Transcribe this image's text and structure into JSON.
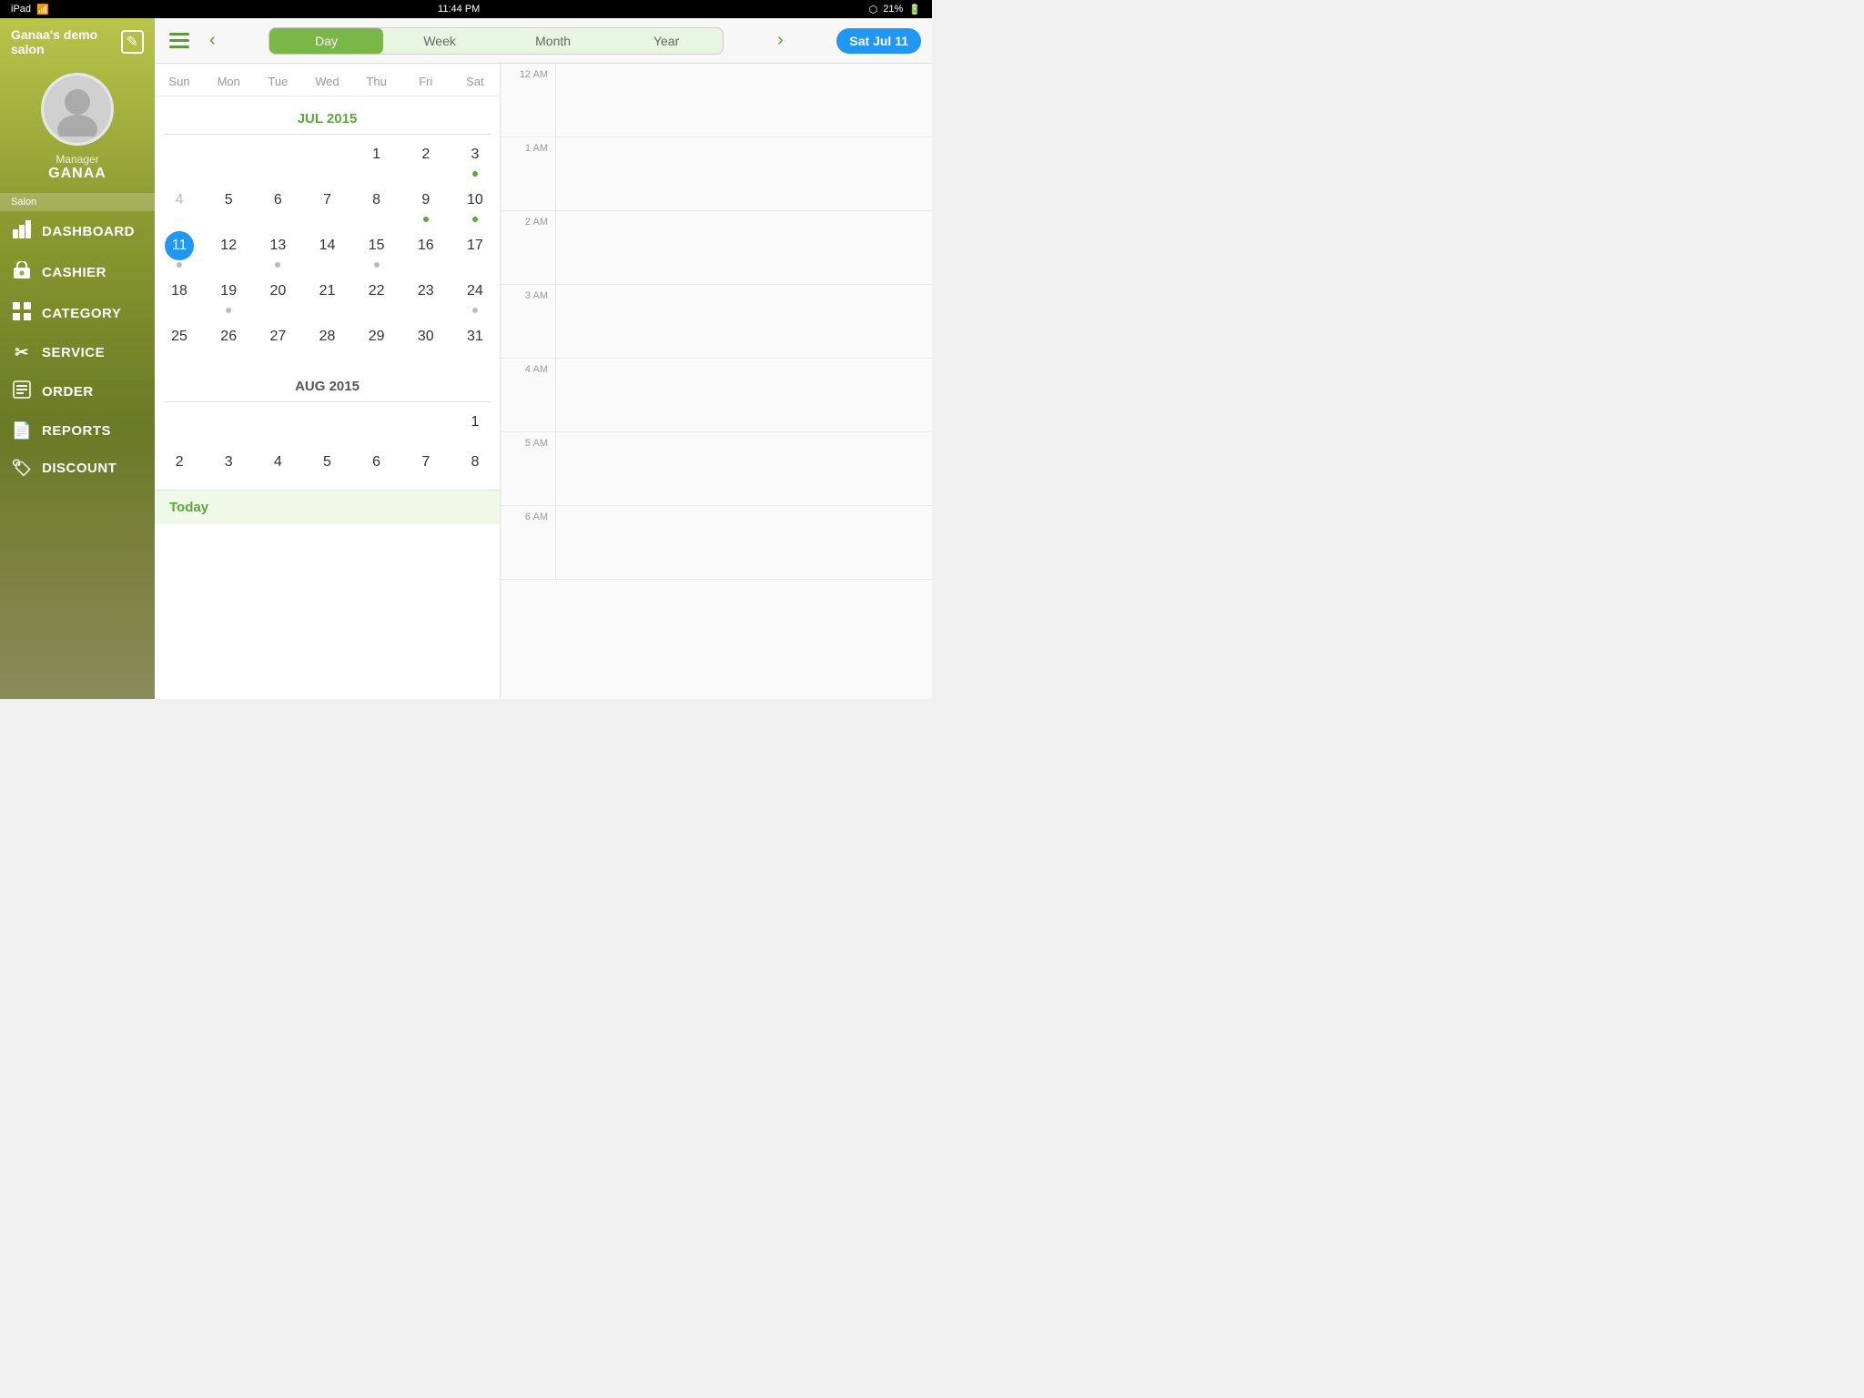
{
  "statusBar": {
    "left": "iPad",
    "wifi": "wifi",
    "time": "11:44 PM",
    "bluetooth": "BT",
    "battery": "21%"
  },
  "sidebar": {
    "salonTitle": "Ganaa's demo salon",
    "editIcon": "✎",
    "user": {
      "role": "Manager",
      "name": "GANAA"
    },
    "sectionLabel": "Salon",
    "navItems": [
      {
        "id": "dashboard",
        "icon": "📊",
        "label": "DASHBOARD"
      },
      {
        "id": "cashier",
        "icon": "🛒",
        "label": "CASHIER"
      },
      {
        "id": "category",
        "icon": "⬛",
        "label": "CATEGORY"
      },
      {
        "id": "service",
        "icon": "✂",
        "label": "SERVICE"
      },
      {
        "id": "order",
        "icon": "📋",
        "label": "ORDER"
      },
      {
        "id": "reports",
        "icon": "📄",
        "label": "REPORTS"
      },
      {
        "id": "discount",
        "icon": "🏷",
        "label": "DISCOUNT"
      }
    ]
  },
  "topBar": {
    "prevLabel": "‹",
    "nextLabel": "›",
    "tabs": [
      {
        "id": "day",
        "label": "Day",
        "active": true
      },
      {
        "id": "week",
        "label": "Week",
        "active": false
      },
      {
        "id": "month",
        "label": "Month",
        "active": false
      },
      {
        "id": "year",
        "label": "Year",
        "active": false
      }
    ],
    "selectedDate": "Sat Jul 11"
  },
  "calendar": {
    "dayHeaders": [
      "Sun",
      "Mon",
      "Tue",
      "Wed",
      "Thu",
      "Fri",
      "Sat"
    ],
    "julTitle": "JUL 2015",
    "augTitle": "AUG 2015",
    "julWeeks": [
      [
        {
          "day": "",
          "dimmed": false
        },
        {
          "day": "",
          "dimmed": false
        },
        {
          "day": "",
          "dimmed": false
        },
        {
          "day": "",
          "dimmed": false
        },
        {
          "day": "1",
          "dimmed": false
        },
        {
          "day": "2",
          "dimmed": false
        },
        {
          "day": "3",
          "dimmed": false,
          "dot": "green"
        }
      ],
      [
        {
          "day": "4",
          "dimmed": true
        },
        {
          "day": "5",
          "dimmed": false
        },
        {
          "day": "6",
          "dimmed": false
        },
        {
          "day": "7",
          "dimmed": false
        },
        {
          "day": "8",
          "dimmed": false
        },
        {
          "day": "9",
          "dimmed": false,
          "dot": "green"
        },
        {
          "day": "10",
          "dimmed": false,
          "dot": "green"
        }
      ],
      [
        {
          "day": "11",
          "selected": true,
          "dot": "gray"
        },
        {
          "day": "12",
          "dimmed": false
        },
        {
          "day": "13",
          "dimmed": false,
          "dot": "gray"
        },
        {
          "day": "14",
          "dimmed": false
        },
        {
          "day": "15",
          "dimmed": false,
          "dot": "gray"
        },
        {
          "day": "16",
          "dimmed": false
        },
        {
          "day": "17",
          "dimmed": false
        }
      ],
      [
        {
          "day": "18",
          "dimmed": false
        },
        {
          "day": "19",
          "dimmed": false,
          "dot": "gray"
        },
        {
          "day": "20",
          "dimmed": false
        },
        {
          "day": "21",
          "dimmed": false
        },
        {
          "day": "22",
          "dimmed": false
        },
        {
          "day": "23",
          "dimmed": false
        },
        {
          "day": "24",
          "dimmed": false,
          "dot": "gray"
        }
      ],
      [
        {
          "day": "25",
          "dimmed": false
        },
        {
          "day": "26",
          "dimmed": false
        },
        {
          "day": "27",
          "dimmed": false
        },
        {
          "day": "28",
          "dimmed": false
        },
        {
          "day": "29",
          "dimmed": false
        },
        {
          "day": "30",
          "dimmed": false
        },
        {
          "day": "31",
          "dimmed": false
        }
      ]
    ],
    "augWeeks": [
      [
        {
          "day": "",
          "dimmed": false
        },
        {
          "day": "",
          "dimmed": false
        },
        {
          "day": "",
          "dimmed": false
        },
        {
          "day": "",
          "dimmed": false
        },
        {
          "day": "",
          "dimmed": false
        },
        {
          "day": "",
          "dimmed": false
        },
        {
          "day": "1",
          "dimmed": false
        }
      ],
      [
        {
          "day": "2",
          "dimmed": false
        },
        {
          "day": "3",
          "dimmed": false
        },
        {
          "day": "4",
          "dimmed": false
        },
        {
          "day": "5",
          "dimmed": false
        },
        {
          "day": "6",
          "dimmed": false
        },
        {
          "day": "7",
          "dimmed": false
        },
        {
          "day": "8",
          "dimmed": false
        }
      ]
    ],
    "todayLabel": "Today"
  },
  "schedule": {
    "times": [
      "12 AM",
      "1 AM",
      "2 AM",
      "3 AM",
      "4 AM",
      "5 AM",
      "6 AM"
    ]
  }
}
